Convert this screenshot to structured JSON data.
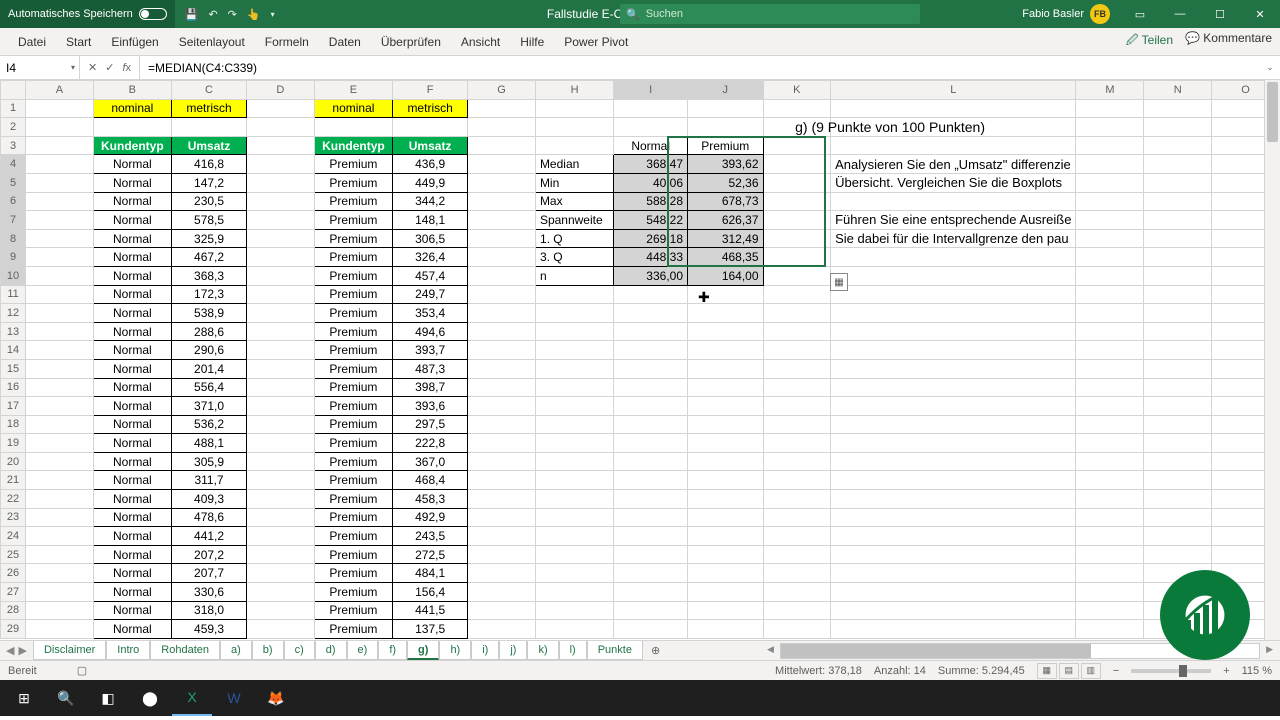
{
  "titlebar": {
    "autosave": "Automatisches Speichern",
    "doc": "Fallstudie E-Commerce Webshop",
    "search_placeholder": "Suchen",
    "user": "Fabio Basler",
    "initials": "FB"
  },
  "ribbon": {
    "tabs": [
      "Datei",
      "Start",
      "Einfügen",
      "Seitenlayout",
      "Formeln",
      "Daten",
      "Überprüfen",
      "Ansicht",
      "Hilfe",
      "Power Pivot"
    ],
    "share": "Teilen",
    "comments": "Kommentare"
  },
  "fbar": {
    "cell": "I4",
    "formula": "=MEDIAN(C4:C339)"
  },
  "cols": [
    "A",
    "B",
    "C",
    "D",
    "E",
    "F",
    "G",
    "H",
    "I",
    "J",
    "K",
    "L",
    "M",
    "N",
    "O"
  ],
  "row1": {
    "b": "nominal",
    "c": "metrisch",
    "e": "nominal",
    "f": "metrisch"
  },
  "hdr": {
    "b": "Kundentyp",
    "c": "Umsatz",
    "e": "Kundentyp",
    "f": "Umsatz"
  },
  "normal_label": "Normal",
  "premium_label": "Premium",
  "umsatz_normal": [
    "416,8",
    "147,2",
    "230,5",
    "578,5",
    "325,9",
    "467,2",
    "368,3",
    "172,3",
    "538,9",
    "288,6",
    "290,6",
    "201,4",
    "556,4",
    "371,0",
    "536,2",
    "488,1",
    "305,9",
    "311,7",
    "409,3",
    "478,6",
    "441,2",
    "207,2",
    "207,7",
    "330,6",
    "318,0",
    "459,3"
  ],
  "umsatz_premium": [
    "436,9",
    "449,9",
    "344,2",
    "148,1",
    "306,5",
    "326,4",
    "457,4",
    "249,7",
    "353,4",
    "494,6",
    "393,7",
    "487,3",
    "398,7",
    "393,6",
    "297,5",
    "222,8",
    "367,0",
    "468,4",
    "458,3",
    "492,9",
    "243,5",
    "272,5",
    "484,1",
    "156,4",
    "441,5",
    "137,5"
  ],
  "stats": {
    "col_i": "Normal",
    "col_j": "Premium",
    "rows": [
      {
        "l": "Median",
        "n": "368,47",
        "p": "393,62"
      },
      {
        "l": "Min",
        "n": "40,06",
        "p": "52,36"
      },
      {
        "l": "Max",
        "n": "588,28",
        "p": "678,73"
      },
      {
        "l": "Spannweite",
        "n": "548,22",
        "p": "626,37"
      },
      {
        "l": "1. Q",
        "n": "269,18",
        "p": "312,49"
      },
      {
        "l": "3. Q",
        "n": "448,33",
        "p": "468,35"
      },
      {
        "l": "n",
        "n": "336,00",
        "p": "164,00"
      }
    ]
  },
  "question": {
    "title": "g) (9 Punkte von 100 Punkten)",
    "l1": "Analysieren Sie den „Umsatz\" differenzie",
    "l2": "Übersicht. Vergleichen Sie die Boxplots",
    "l3": "Führen Sie eine entsprechende Ausreiße",
    "l4": "Sie dabei für die Intervallgrenze den pau"
  },
  "sheets": [
    "Disclaimer",
    "Intro",
    "Rohdaten",
    "a)",
    "b)",
    "c)",
    "d)",
    "e)",
    "f)",
    "g)",
    "h)",
    "i)",
    "j)",
    "k)",
    "l)",
    "Punkte"
  ],
  "active_sheet": "g)",
  "status": {
    "ready": "Bereit",
    "avg_l": "Mittelwert:",
    "avg": "378,18",
    "cnt_l": "Anzahl:",
    "cnt": "14",
    "sum_l": "Summe:",
    "sum": "5.294,45",
    "zoom": "115 %"
  }
}
